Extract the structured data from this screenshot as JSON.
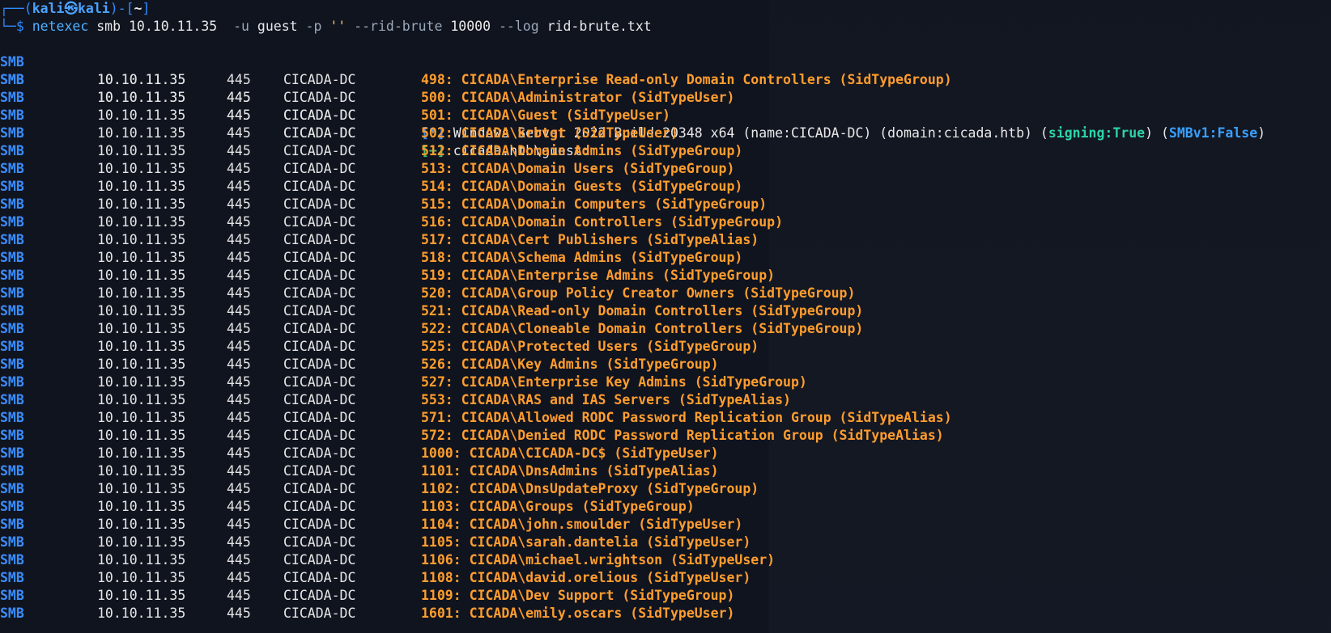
{
  "prompt": {
    "line1_prefix": "┌──(",
    "user": "kali㉿kali",
    "line1_mid": ")-[",
    "cwd": "~",
    "line1_suffix": "]",
    "line2_prefix": "└─$ "
  },
  "command": {
    "bin": "netexec",
    "part1": " smb 10.10.11.35  ",
    "flag_u": "-u",
    "user": " guest ",
    "flag_p": "-p",
    "pass": " '' ",
    "flag_rid": "--rid-brute",
    "rid_max": " 10000 ",
    "flag_log": "--log",
    "logfile": " rid-brute.txt"
  },
  "columns": {
    "proto": "SMB",
    "ip": "10.10.11.35",
    "port": "445",
    "host": "CICADA-DC"
  },
  "info": {
    "tag": "[*]",
    "text": " Windows Server 2022 Build 20348 x64 (name:CICADA-DC) (domain:cicada.htb) (",
    "signing": "signing:True",
    "mid": ") (",
    "smbv1": "SMBv1:False",
    "end": ")"
  },
  "auth": {
    "tag": "[+]",
    "text": " cicada.htb\\guest:"
  },
  "rids": [
    "498: CICADA\\Enterprise Read-only Domain Controllers (SidTypeGroup)",
    "500: CICADA\\Administrator (SidTypeUser)",
    "501: CICADA\\Guest (SidTypeUser)",
    "502: CICADA\\krbtgt (SidTypeUser)",
    "512: CICADA\\Domain Admins (SidTypeGroup)",
    "513: CICADA\\Domain Users (SidTypeGroup)",
    "514: CICADA\\Domain Guests (SidTypeGroup)",
    "515: CICADA\\Domain Computers (SidTypeGroup)",
    "516: CICADA\\Domain Controllers (SidTypeGroup)",
    "517: CICADA\\Cert Publishers (SidTypeAlias)",
    "518: CICADA\\Schema Admins (SidTypeGroup)",
    "519: CICADA\\Enterprise Admins (SidTypeGroup)",
    "520: CICADA\\Group Policy Creator Owners (SidTypeGroup)",
    "521: CICADA\\Read-only Domain Controllers (SidTypeGroup)",
    "522: CICADA\\Cloneable Domain Controllers (SidTypeGroup)",
    "525: CICADA\\Protected Users (SidTypeGroup)",
    "526: CICADA\\Key Admins (SidTypeGroup)",
    "527: CICADA\\Enterprise Key Admins (SidTypeGroup)",
    "553: CICADA\\RAS and IAS Servers (SidTypeAlias)",
    "571: CICADA\\Allowed RODC Password Replication Group (SidTypeAlias)",
    "572: CICADA\\Denied RODC Password Replication Group (SidTypeAlias)",
    "1000: CICADA\\CICADA-DC$ (SidTypeUser)",
    "1101: CICADA\\DnsAdmins (SidTypeAlias)",
    "1102: CICADA\\DnsUpdateProxy (SidTypeGroup)",
    "1103: CICADA\\Groups (SidTypeGroup)",
    "1104: CICADA\\john.smoulder (SidTypeUser)",
    "1105: CICADA\\sarah.dantelia (SidTypeUser)",
    "1106: CICADA\\michael.wrightson (SidTypeUser)",
    "1108: CICADA\\david.orelious (SidTypeUser)",
    "1109: CICADA\\Dev Support (SidTypeGroup)",
    "1601: CICADA\\emily.oscars (SidTypeUser)"
  ]
}
